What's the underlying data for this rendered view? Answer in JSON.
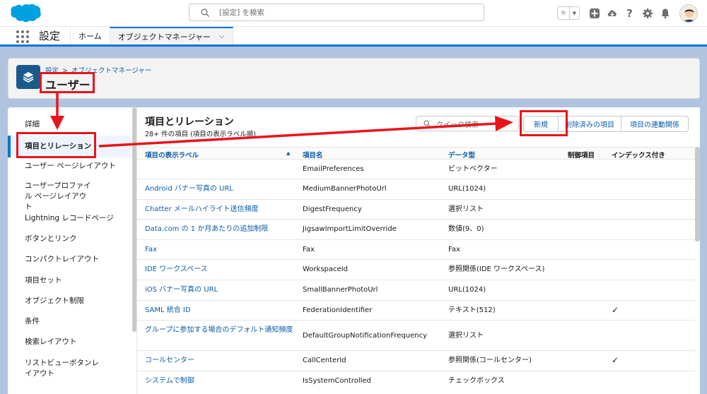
{
  "header": {
    "search_placeholder": "[設定] を検索",
    "icons": [
      "favorites-star-icon",
      "chevron-down-icon",
      "add-icon",
      "trailhead-icon",
      "help-icon",
      "setup-gear-icon",
      "notification-bell-icon",
      "user-avatar"
    ]
  },
  "nav": {
    "app_name": "設定",
    "tabs": [
      {
        "label": "ホーム"
      },
      {
        "label": "オブジェクトマネージャー",
        "active": true
      }
    ]
  },
  "page": {
    "breadcrumb": [
      "設定",
      "オブジェクトマネージャー"
    ],
    "breadcrumb_sep": ">",
    "title": "ユーザー"
  },
  "sidebar": {
    "items": [
      {
        "label": "詳細"
      },
      {
        "label": "項目とリレーション",
        "active": true
      },
      {
        "label": "ユーザー ページレイアウト"
      },
      {
        "label": "ユーザープロファイル ページレイアウト"
      },
      {
        "label": "Lightning レコードページ"
      },
      {
        "label": "ボタンとリンク"
      },
      {
        "label": "コンパクトレイアウト"
      },
      {
        "label": "項目セット"
      },
      {
        "label": "オブジェクト制限"
      },
      {
        "label": "条件"
      },
      {
        "label": "検索レイアウト"
      },
      {
        "label": "リストビューボタンレイアウト"
      }
    ]
  },
  "main": {
    "title": "項目とリレーション",
    "subtitle": "28+ 件の項目 (項目の表示ラベル順)",
    "quick_search_placeholder": "クイック検索",
    "buttons": {
      "new": "新規",
      "deleted": "削除済みの項目",
      "dependencies": "項目の連動関係"
    },
    "columns": [
      "項目の表示ラベル",
      "項目名",
      "データ型",
      "制御項目",
      "インデックス付き"
    ],
    "rows": [
      {
        "label": "",
        "api": "EmailPreferences",
        "type": "ビットベクター",
        "indexed": ""
      },
      {
        "label": "Android バナー写真の URL",
        "api": "MediumBannerPhotoUrl",
        "type": "URL(1024)",
        "indexed": ""
      },
      {
        "label": "Chatter メールハイライト送信頻度",
        "api": "DigestFrequency",
        "type": "選択リスト",
        "indexed": ""
      },
      {
        "label": "Data.com の 1 か月あたりの追加制限",
        "api": "JigsawImportLimitOverride",
        "type": "数値(9、0)",
        "indexed": ""
      },
      {
        "label": "Fax",
        "api": "Fax",
        "type": "Fax",
        "indexed": ""
      },
      {
        "label": "IDE ワークスペース",
        "api": "WorkspaceId",
        "type": "参照関係(IDE ワークスペース)",
        "indexed": ""
      },
      {
        "label": "iOS バナー写真の URL",
        "api": "SmallBannerPhotoUrl",
        "type": "URL(1024)",
        "indexed": ""
      },
      {
        "label": "SAML 統合 ID",
        "api": "FederationIdentifier",
        "type": "テキスト(512)",
        "indexed": "✓"
      },
      {
        "label": "グループに参加する場合のデフォルト通知頻度",
        "api": "DefaultGroupNotificationFrequency",
        "type": "選択リスト",
        "indexed": ""
      },
      {
        "label": "コールセンター",
        "api": "CallCenterId",
        "type": "参照関係(コールセンター)",
        "indexed": "✓"
      },
      {
        "label": "システムで制御",
        "api": "IsSystemControlled",
        "type": "チェックボックス",
        "indexed": ""
      }
    ]
  },
  "colors": {
    "annotation_red": "#e8141c",
    "link_blue": "#0b5cab",
    "brand_blue": "#0176d3",
    "background": "#b0c4df"
  }
}
